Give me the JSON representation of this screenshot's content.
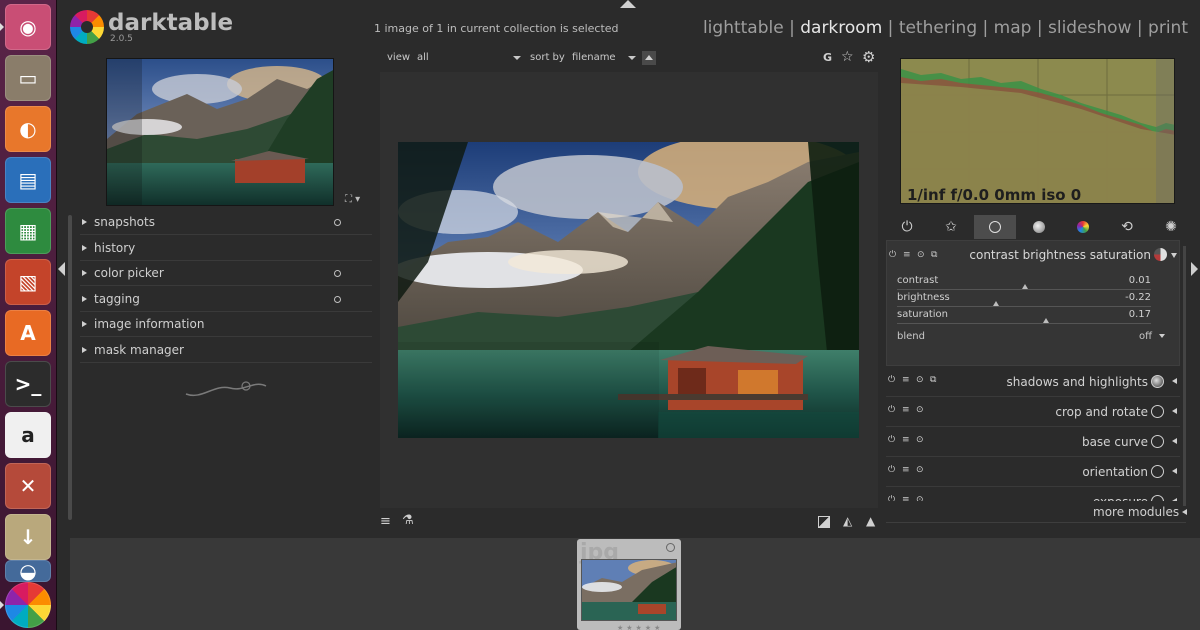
{
  "launcher": {
    "items": [
      {
        "name": "ubuntu-dash",
        "color": "#c94e75"
      },
      {
        "name": "files",
        "color": "#8a7d6a"
      },
      {
        "name": "firefox",
        "color": "#e8772b"
      },
      {
        "name": "libreoffice-writer",
        "color": "#2a6fba"
      },
      {
        "name": "libreoffice-calc",
        "color": "#2e8b3f"
      },
      {
        "name": "libreoffice-impress",
        "color": "#c4442a"
      },
      {
        "name": "ubuntu-software",
        "color": "#e86a24"
      },
      {
        "name": "terminal",
        "color": "#2c2c2c"
      },
      {
        "name": "amazon",
        "color": "#f0f0f0"
      },
      {
        "name": "system-settings",
        "color": "#b54a3a"
      },
      {
        "name": "downloads",
        "color": "#b9a87c"
      },
      {
        "name": "disk",
        "color": "#446a9a"
      },
      {
        "name": "darktable",
        "color": "#222222"
      }
    ]
  },
  "header": {
    "app_name": "darktable",
    "app_version": "2.0.5",
    "collection_status": "1 image of 1 in current collection is selected",
    "views": [
      "lighttable",
      "darkroom",
      "tethering",
      "map",
      "slideshow",
      "print"
    ],
    "active_view": "darkroom",
    "separator": " | "
  },
  "left_panel": {
    "modules": [
      {
        "label": "snapshots",
        "has_dot": true
      },
      {
        "label": "history",
        "has_dot": false
      },
      {
        "label": "color picker",
        "has_dot": true
      },
      {
        "label": "tagging",
        "has_dot": true
      },
      {
        "label": "image information",
        "has_dot": false
      },
      {
        "label": "mask manager",
        "has_dot": false
      }
    ]
  },
  "center": {
    "view_label": "view",
    "view_value": "all",
    "sort_label": "sort by",
    "sort_value": "filename",
    "grouping_label": "G"
  },
  "right_panel": {
    "histogram_info": "1/inf f/0.0 0mm iso 0",
    "expanded_module": {
      "name": "contrast brightness saturation",
      "sliders": [
        {
          "label": "contrast",
          "value": "0.01",
          "pos": 0.505
        },
        {
          "label": "brightness",
          "value": "-0.22",
          "pos": 0.39
        },
        {
          "label": "saturation",
          "value": "0.17",
          "pos": 0.585
        }
      ],
      "blend_label": "blend",
      "blend_value": "off"
    },
    "modules": [
      {
        "name": "shadows and highlights"
      },
      {
        "name": "crop and rotate"
      },
      {
        "name": "base curve"
      },
      {
        "name": "orientation"
      },
      {
        "name": "exposure"
      }
    ],
    "more_modules": "more modules"
  },
  "filmstrip": {
    "extension": "jpg"
  }
}
